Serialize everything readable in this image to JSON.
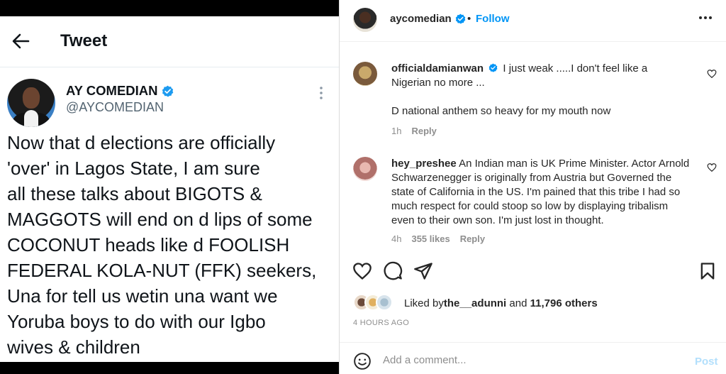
{
  "tweet": {
    "header_title": "Tweet",
    "author_name": "AY COMEDIAN",
    "author_handle": "@AYCOMEDIAN",
    "text": "Now that d  elections are officially\n'over' in Lagos State, I am sure\nall these talks about BIGOTS &\nMAGGOTS will end on d lips of some\nCOCONUT heads like d FOOLISH\nFEDERAL KOLA-NUT (FFK) seekers,\nUna for tell us wetin una want we\nYoruba boys to do with our Igbo\nwives & children"
  },
  "instagram": {
    "post_author": "aycomedian",
    "separator": "•",
    "follow_label": "Follow",
    "comments": [
      {
        "username": "officialdamianwan",
        "text_line1": "I just weak .....I don't feel like a Nigerian no more ...",
        "text_line2": "D national anthem so heavy for my mouth now",
        "age": "1h",
        "reply": "Reply"
      },
      {
        "username": "hey_preshee",
        "text": "An Indian man is UK Prime Minister. Actor Arnold Schwarzenegger is originally from Austria but Governed the state of California in the US. I'm pained that this tribe I had so much respect for could stoop so low by displaying tribalism even to their own son. I'm just lost in thought.",
        "age": "4h",
        "likes": "355 likes",
        "reply": "Reply"
      }
    ],
    "liked_by_prefix": "Liked by ",
    "liked_by_user": "the__adunni",
    "liked_by_and": " and ",
    "liked_by_others": "11,796 others",
    "timestamp": "4 HOURS AGO",
    "comment_placeholder": "Add a comment...",
    "post_label": "Post"
  },
  "colors": {
    "verified": "#1d9bf0",
    "ig_verified": "#0095f6",
    "link_blue": "#0095f6",
    "post_disabled": "#b2dffc"
  }
}
